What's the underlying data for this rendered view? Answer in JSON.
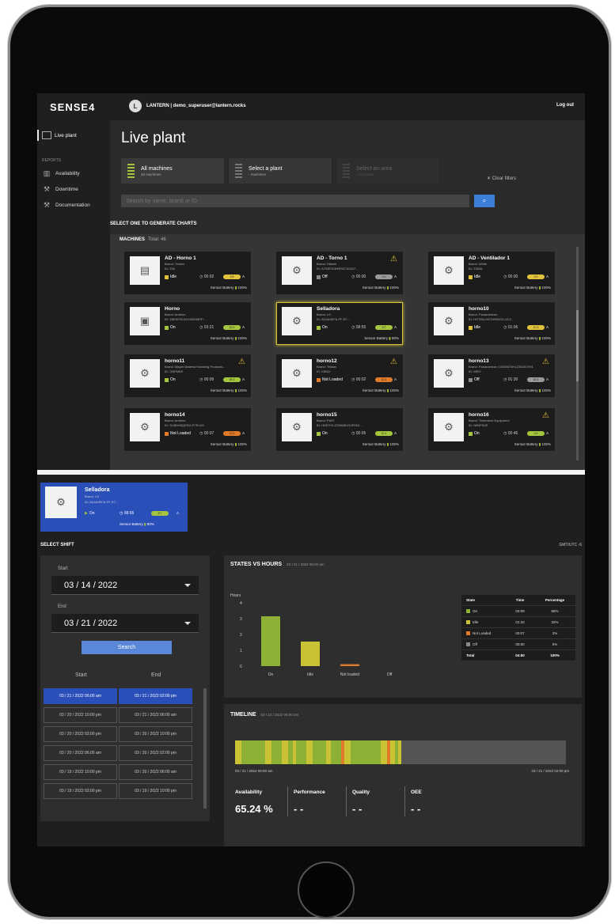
{
  "app": {
    "logo": "SENSE4",
    "tenant": "LANTERN | demo_superuser@lantern.rocks",
    "avatar": "L",
    "logout": "Log out"
  },
  "sidebar": {
    "active": "Live plant",
    "section": "REPORTS",
    "items": [
      {
        "label": "Availability",
        "icon": "chart-icon"
      },
      {
        "label": "Downtime",
        "icon": "wrench-icon"
      },
      {
        "label": "Documentation",
        "icon": "wrench-icon"
      }
    ]
  },
  "page": {
    "title": "Live plant"
  },
  "filters": [
    {
      "title": "All machines",
      "sub": "46 machines"
    },
    {
      "title": "Select a plant",
      "sub": "- machines"
    },
    {
      "title": "Select an area",
      "sub": "- machines"
    }
  ],
  "clear_filters": "Clear filters",
  "search": {
    "placeholder": "Search by name, brand or ID"
  },
  "select_hint": "SELECT ONE TO GENERATE CHARTS",
  "machines": {
    "title": "MACHINES",
    "total": "Total: 46"
  },
  "cards": [
    {
      "name": "AD - Horno 1",
      "brand": "Brand: Tristan",
      "id": "ID: 226",
      "state": "Idle",
      "state_color": "#e3c23b",
      "time": "00:02",
      "pill": "9.8",
      "pill_color": "#e3c23b",
      "battery": "100%",
      "warn": false,
      "img": "oven"
    },
    {
      "name": "AD - Torno 1",
      "brand": "Brand: Hitachi",
      "id": "ID: A7SEFD3H0FBC1D4S7...",
      "state": "Off",
      "state_color": "#888",
      "time": "00:00",
      "pill": "0.0",
      "pill_color": "#999",
      "battery": "100%",
      "warn": true,
      "img": "robot"
    },
    {
      "name": "AD - Ventilador 1",
      "brand": "Brand: White",
      "id": "ID: 22836",
      "state": "Idle",
      "state_color": "#e3c23b",
      "time": "00:00",
      "pill": "0.0",
      "pill_color": "#e3c23b",
      "battery": "100%",
      "warn": false,
      "img": "robot"
    },
    {
      "name": "Horno",
      "brand": "Brand: Amitron",
      "id": "ID: 1BEAF9C0G4HD0987P...",
      "state": "On",
      "state_color": "#a5c43d",
      "time": "03:21",
      "pill": "18.9",
      "pill_color": "#a5c43d",
      "battery": "100%",
      "warn": false,
      "img": "oven2"
    },
    {
      "name": "Selladora",
      "brand": "Brand: LG",
      "id": "ID: AD4A9EFA-FF-R7...",
      "state": "On",
      "state_color": "#a5c43d",
      "time": "08:55",
      "pill": "8.7",
      "pill_color": "#a5c43d",
      "battery": "80%",
      "warn": false,
      "img": "sealer",
      "highlight": true
    },
    {
      "name": "horno10",
      "brand": "Brand: Panamerican",
      "id": "ID: HG7EB-HG7HRBIGV-UCZ...",
      "state": "Idle",
      "state_color": "#e3c23b",
      "time": "01:06",
      "pill": "10.3",
      "pill_color": "#e3c23b",
      "battery": "100%",
      "warn": false,
      "img": "robot"
    },
    {
      "name": "horno11",
      "brand": "Brand: Mayer Material Handling Products...",
      "id": "ID: OBPMKE",
      "state": "On",
      "state_color": "#a5c43d",
      "time": "00:09",
      "pill": "26.3",
      "pill_color": "#a5c43d",
      "battery": "100%",
      "warn": true,
      "img": "robot"
    },
    {
      "name": "horno12",
      "brand": "Brand: Tristan",
      "id": "ID: KBND",
      "state": "Not Loaded",
      "state_color": "#e07a28",
      "time": "00:02",
      "pill": "10.1",
      "pill_color": "#e07a28",
      "battery": "100%",
      "warn": true,
      "img": "robot"
    },
    {
      "name": "horno13",
      "brand": "Brand: Panamerican 10045670H1234G67E91",
      "id": "ID: MRO",
      "state": "Off",
      "state_color": "#888",
      "time": "01:30",
      "pill": "18.1",
      "pill_color": "#999",
      "battery": "100%",
      "warn": true,
      "img": "robot"
    },
    {
      "name": "horno14",
      "brand": "Brand: Amitron",
      "id": "ID: SU8DH9QESG-P7ELK9",
      "state": "Not Loaded",
      "state_color": "#e07a28",
      "time": "00:07",
      "pill": "13.3",
      "pill_color": "#e07a28",
      "battery": "100%",
      "warn": false,
      "img": "robot"
    },
    {
      "name": "horno15",
      "brand": "Brand: PWG",
      "id": "ID: HDEYHLZZ5H6EUSJF6N1...",
      "state": "On",
      "state_color": "#a5c43d",
      "time": "00:05",
      "pill": "12.1",
      "pill_color": "#a5c43d",
      "battery": "100%",
      "warn": false,
      "img": "robot"
    },
    {
      "name": "horno16",
      "brand": "Brand: Tinkerland Equipment",
      "id": "ID: N9NF5UE",
      "state": "On",
      "state_color": "#a5c43d",
      "time": "00:46",
      "pill": "3.9",
      "pill_color": "#a5c43d",
      "battery": "100%",
      "warn": true,
      "img": "robot"
    }
  ],
  "card_labels": {
    "sensor_battery": "Sensor Battery",
    "amp": "A"
  },
  "selected": {
    "name": "Selladora",
    "brand": "Brand: LG",
    "id": "ID: AD4A9EFA-FF-R7...",
    "state": "On",
    "time": "08:55",
    "pill": "8.7",
    "amp": "A",
    "battery_label": "Sensor Battery",
    "battery": "80%"
  },
  "shift": {
    "title": "SELECT SHIFT",
    "tz": "GMT/UTC -6",
    "start_label": "Start",
    "start": "03 / 14 / 2022",
    "end_label": "End",
    "end": "03 / 21 / 2022",
    "search": "Search",
    "col_start": "Start",
    "col_end": "End",
    "rows": [
      [
        "03 / 21 / 2022  06:00 am",
        "03 / 21 / 2022  02:00 pm"
      ],
      [
        "03 / 20 / 2022  10:00 pm",
        "03 / 21 / 2022  06:00 am"
      ],
      [
        "03 / 20 / 2022  02:00 pm",
        "03 / 20 / 2022  10:00 pm"
      ],
      [
        "03 / 20 / 2022  06:00 am",
        "03 / 20 / 2022  02:00 pm"
      ],
      [
        "03 / 19 / 2022  10:00 pm",
        "03 / 20 / 2022  06:00 am"
      ],
      [
        "03 / 19 / 2022  02:00 pm",
        "03 / 19 / 2022  10:00 pm"
      ]
    ]
  },
  "states_vs_hours": {
    "title": "STATES VS HOURS",
    "date": "03 / 21 / 2022  06:00 am"
  },
  "chart_data": {
    "type": "bar",
    "ylabel": "Hours",
    "categories": [
      "On",
      "Idle",
      "Not loaded",
      "Off"
    ],
    "values": [
      3.15,
      1.55,
      0.12,
      0
    ],
    "colors": [
      "#8cb135",
      "#c9c235",
      "#e07a28",
      "#888888"
    ],
    "yticks": [
      0,
      1,
      2,
      3,
      4
    ],
    "ylim": [
      0,
      4
    ]
  },
  "state_table": {
    "headers": [
      "State",
      "Time",
      "Percentage"
    ],
    "rows": [
      {
        "state": "On",
        "time": "03:09",
        "pct": "65%",
        "color": "#8cb135"
      },
      {
        "state": "Idle",
        "time": "01:33",
        "pct": "32%",
        "color": "#c9c235"
      },
      {
        "state": "Not Loaded",
        "time": "00:07",
        "pct": "2%",
        "color": "#e07a28"
      },
      {
        "state": "Off",
        "time": "00:00",
        "pct": "0%",
        "color": "#888888"
      }
    ],
    "total": {
      "state": "Total",
      "time": "04:50",
      "pct": "100%"
    }
  },
  "timeline": {
    "title": "TIMELINE",
    "date": "03 / 21 / 2022  06:00 am",
    "start": "03 / 21 / 2022 06:00 am",
    "end": "03 / 21 / 2022 02:00 pm",
    "segments": [
      {
        "w": 2,
        "c": "#c9c235"
      },
      {
        "w": 7,
        "c": "#8cb135"
      },
      {
        "w": 2,
        "c": "#c9c235"
      },
      {
        "w": 3,
        "c": "#8cb135"
      },
      {
        "w": 2,
        "c": "#c9c235"
      },
      {
        "w": 1.5,
        "c": "#8cb135"
      },
      {
        "w": 1,
        "c": "#c9c235"
      },
      {
        "w": 3,
        "c": "#8cb135"
      },
      {
        "w": 2,
        "c": "#c9c235"
      },
      {
        "w": 4,
        "c": "#8cb135"
      },
      {
        "w": 1.5,
        "c": "#c9c235"
      },
      {
        "w": 3,
        "c": "#8cb135"
      },
      {
        "w": 1,
        "c": "#e07a28"
      },
      {
        "w": 2,
        "c": "#c9c235"
      },
      {
        "w": 9,
        "c": "#8cb135"
      },
      {
        "w": 2,
        "c": "#c9c235"
      },
      {
        "w": 0.8,
        "c": "#e07a28"
      },
      {
        "w": 1.5,
        "c": "#c9c235"
      },
      {
        "w": 1,
        "c": "#8cb135"
      },
      {
        "w": 1,
        "c": "#c9c235"
      },
      {
        "w": 37.7,
        "c": "#555555"
      }
    ],
    "kpis": [
      {
        "label": "Availability",
        "value": "65.24 %"
      },
      {
        "label": "Performance",
        "value": "- -"
      },
      {
        "label": "Quality",
        "value": "- -"
      },
      {
        "label": "OEE",
        "value": "- -"
      }
    ]
  }
}
